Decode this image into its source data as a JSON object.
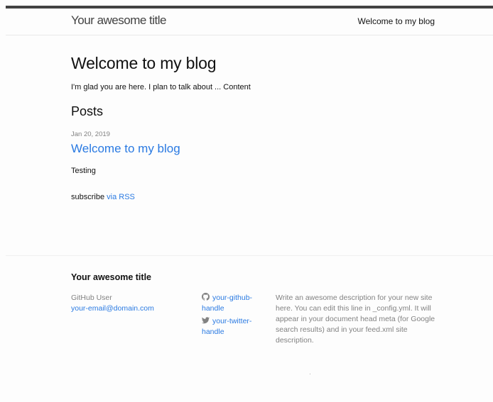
{
  "header": {
    "site_title": "Your awesome title",
    "nav_label": "Welcome to my blog"
  },
  "main": {
    "heading": "Welcome to my blog",
    "intro": "I'm glad you are here. I plan to talk about ... Content",
    "posts_heading": "Posts",
    "posts": [
      {
        "date": "Jan 20, 2019",
        "title": "Welcome to my blog",
        "excerpt": "Testing"
      }
    ],
    "subscribe_prefix": "subscribe ",
    "subscribe_link": "via RSS"
  },
  "footer": {
    "title": "Your awesome title",
    "name": "GitHub User",
    "email": "your-email@domain.com",
    "github_handle": "your-github-handle",
    "twitter_handle": "your-twitter-handle",
    "description": "Write an awesome description for your new site here. You can edit this line in _config.yml. It will appear in your document head meta (for Google search results) and in your feed.xml site description."
  },
  "colors": {
    "link": "#2a7ae2",
    "text": "#111111",
    "muted": "#828282",
    "top_bar": "#424242"
  },
  "icons": {
    "github": "github-icon",
    "twitter": "twitter-icon"
  }
}
